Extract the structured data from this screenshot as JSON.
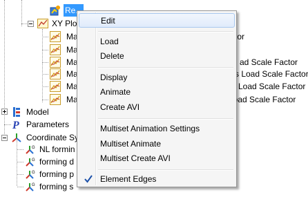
{
  "tree": {
    "top_selected_label": "Re...",
    "xy_plot_label": "XY Plo",
    "plot_items": [
      {
        "label": "Ma",
        "suffix": "tor"
      },
      {
        "label": "Ma",
        "suffix": ""
      },
      {
        "label": "Ma",
        "suffix": "ad Scale Factor"
      },
      {
        "label": "Ma",
        "suffix": "s Load Scale Factor"
      },
      {
        "label": "Ma",
        "suffix": "Load Scale Factor"
      },
      {
        "label": "Ma",
        "suffix": "us Load Scale Factor"
      }
    ],
    "model_label": "Model",
    "parameters_label": "Parameters",
    "coord_label": "Coordinate Sy",
    "coord_items": [
      {
        "label": "NL formin"
      },
      {
        "label": "forming d"
      },
      {
        "label": "forming p"
      },
      {
        "label": "forming s"
      }
    ]
  },
  "context_menu": {
    "items": [
      {
        "label": "Edit",
        "highlighted": true
      },
      {
        "label": "Load"
      },
      {
        "label": "Delete"
      },
      {
        "label": "Display"
      },
      {
        "label": "Animate"
      },
      {
        "label": "Create AVI"
      },
      {
        "label": "Multiset Animation Settings"
      },
      {
        "label": "Multiset Animate"
      },
      {
        "label": "Multiset Create AVI"
      },
      {
        "label": "Element Edges",
        "checked": true
      }
    ]
  },
  "colors": {
    "selection": "#3399ff",
    "menu_background": "#f5f5f5",
    "highlight_border": "#a8c8ef",
    "check": "#1a4fa8"
  }
}
